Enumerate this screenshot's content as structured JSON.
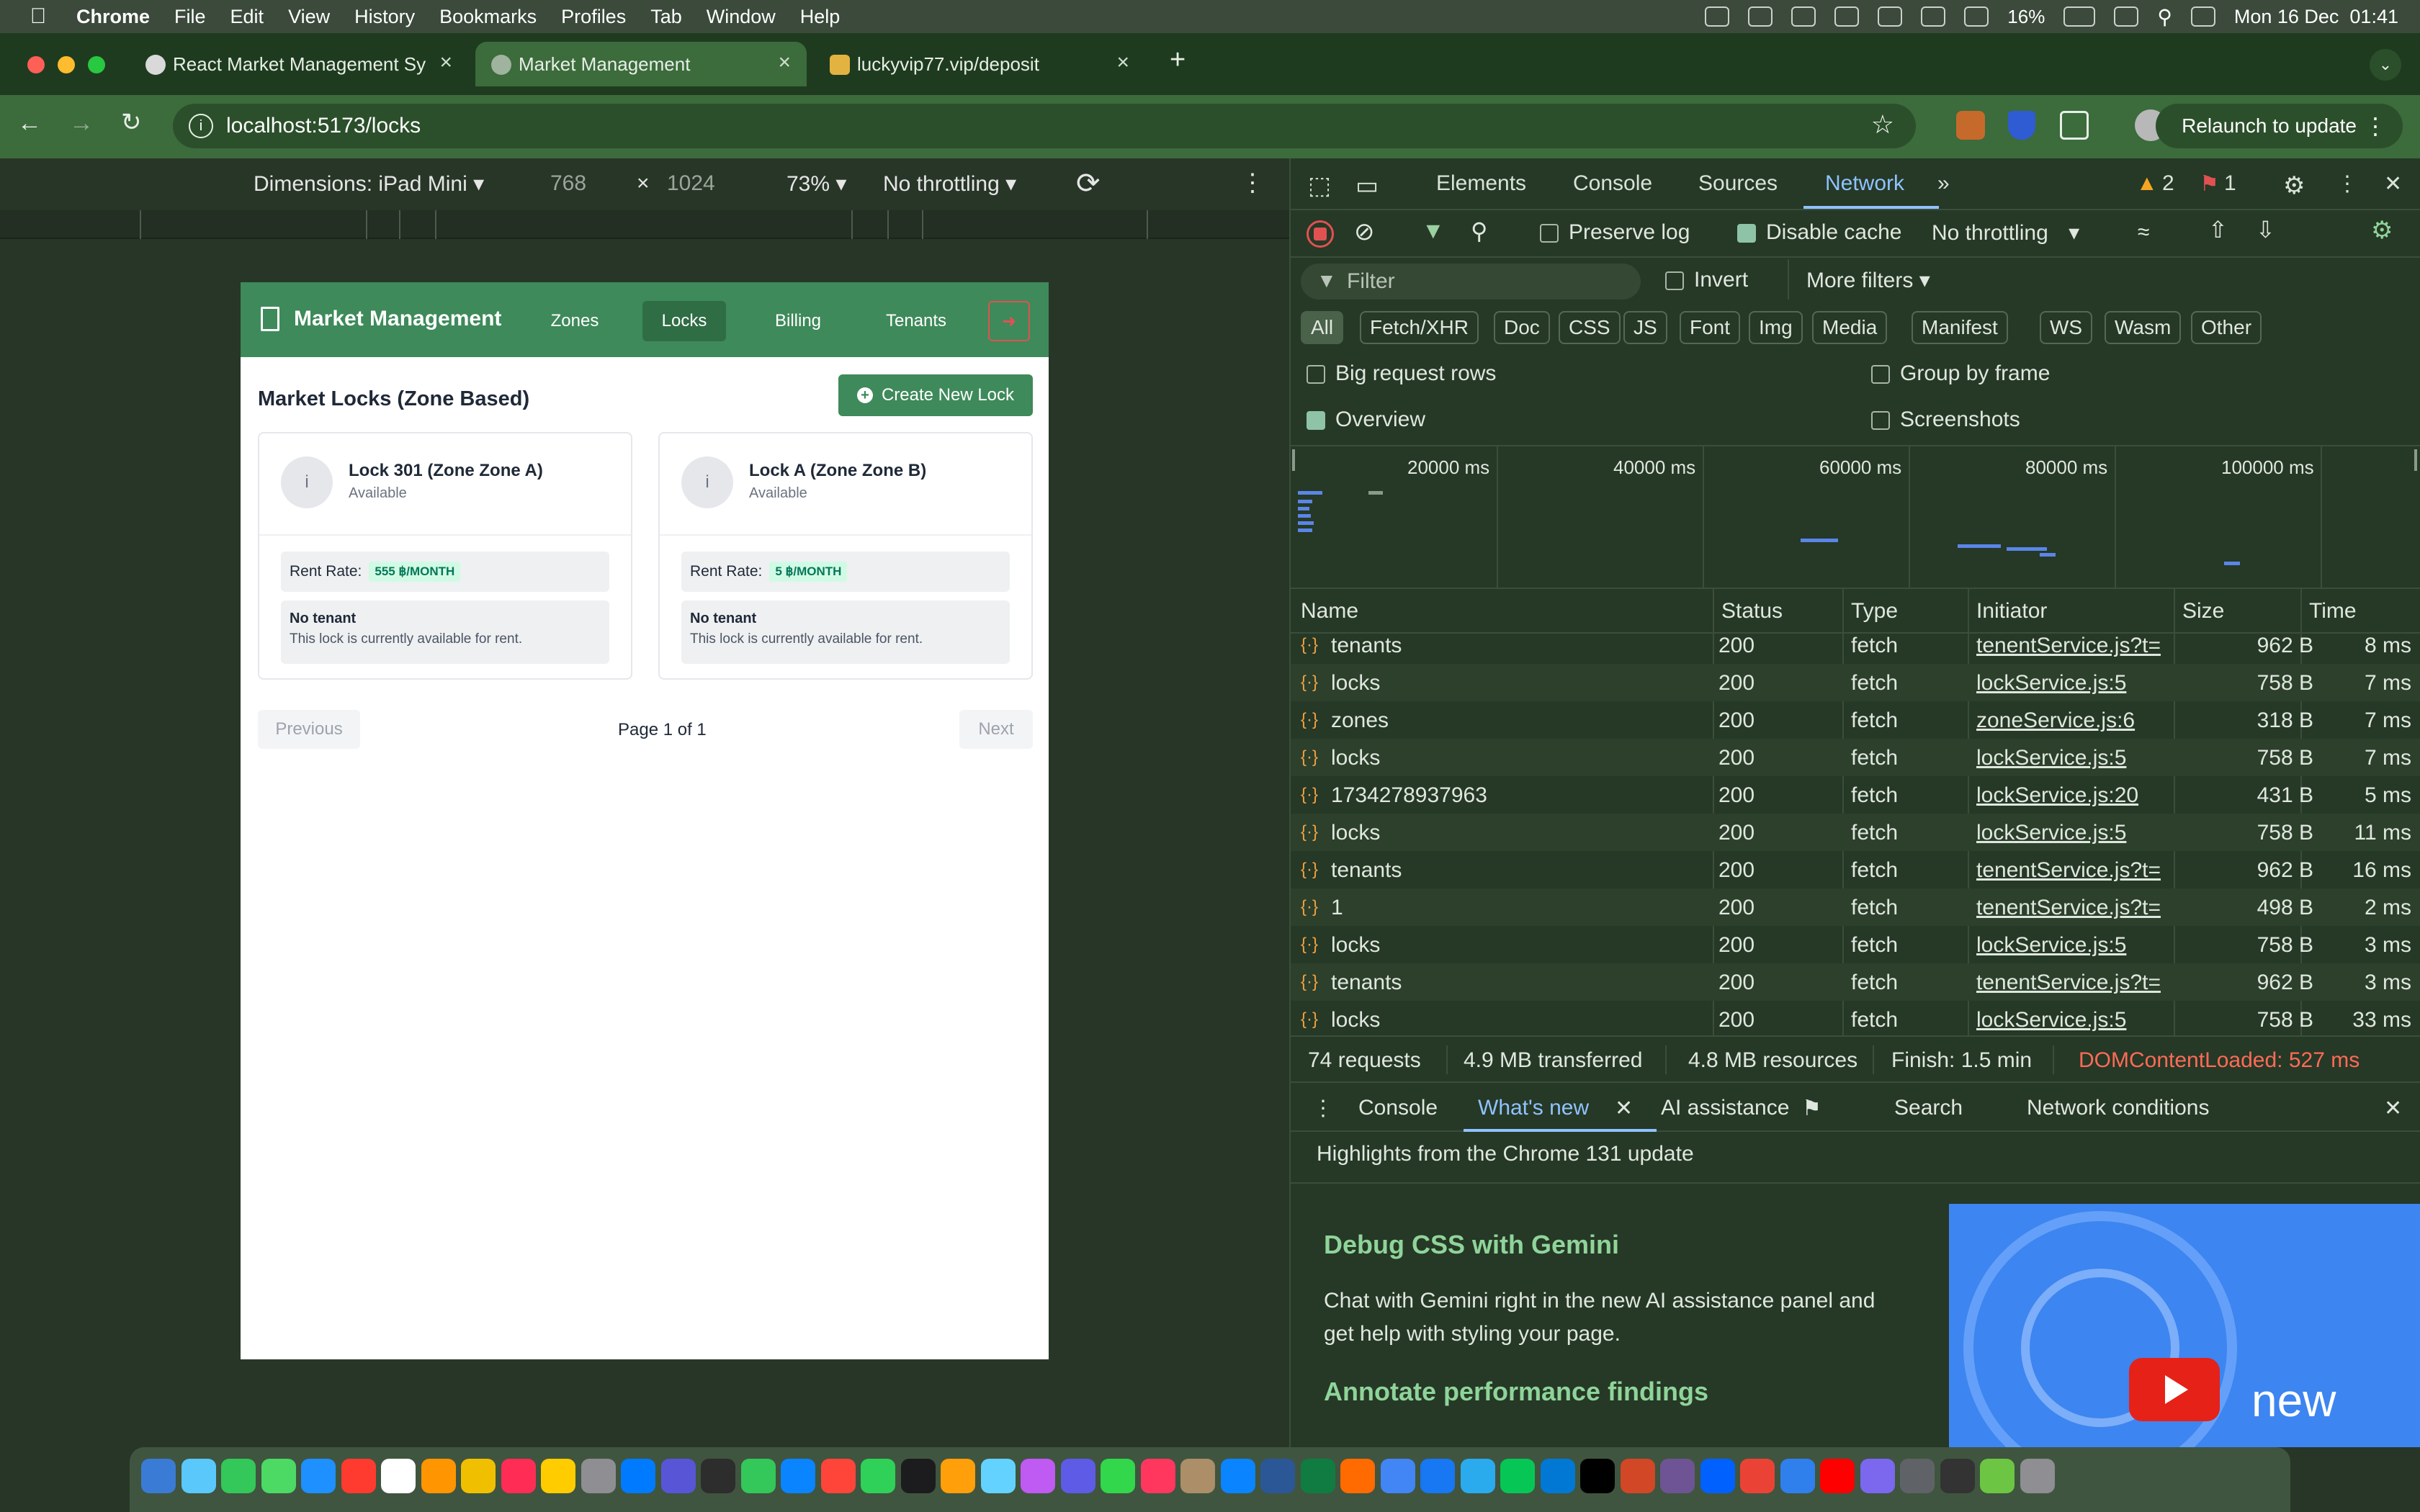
{
  "menubar": {
    "app": "Chrome",
    "items": [
      "File",
      "Edit",
      "View",
      "History",
      "Bookmarks",
      "Profiles",
      "Tab",
      "Window",
      "Help"
    ],
    "battery": "16%",
    "datetime": "Mon 16 Dec  01:41"
  },
  "browser": {
    "tabs": [
      {
        "title": "React Market Management Sy",
        "active": false
      },
      {
        "title": "Market Management",
        "active": true
      },
      {
        "title": "luckyvip77.vip/deposit",
        "active": false
      }
    ],
    "url": "localhost:5173/locks",
    "relaunch_label": "Relaunch to update"
  },
  "device_toolbar": {
    "dimensions_label": "Dimensions: iPad Mini",
    "width": "768",
    "times": "×",
    "height": "1024",
    "zoom": "73%",
    "throttling": "No throttling"
  },
  "app": {
    "brand": "Market Management",
    "nav": [
      {
        "label": "Zones",
        "active": false
      },
      {
        "label": "Locks",
        "active": true
      },
      {
        "label": "Billing",
        "active": false
      },
      {
        "label": "Tenants",
        "active": false
      }
    ],
    "page_title": "Market Locks (Zone Based)",
    "create_button": "Create New Lock",
    "locks": [
      {
        "name": "Lock 301 (Zone Zone A)",
        "status": "Available",
        "rent_label": "Rent Rate:",
        "rent_value": "555 ฿/MONTH",
        "tenant_title": "No tenant",
        "tenant_desc": "This lock is currently available for rent."
      },
      {
        "name": "Lock A (Zone Zone B)",
        "status": "Available",
        "rent_label": "Rent Rate:",
        "rent_value": "5 ฿/MONTH",
        "tenant_title": "No tenant",
        "tenant_desc": "This lock is currently available for rent."
      }
    ],
    "pagination": {
      "previous": "Previous",
      "info": "Page 1 of 1",
      "next": "Next"
    }
  },
  "devtools": {
    "tabs": [
      "Elements",
      "Console",
      "Sources",
      "Network"
    ],
    "active_tab": "Network",
    "warnings": "2",
    "errors": "1",
    "toolbar": {
      "preserve_log": "Preserve log",
      "preserve_log_checked": false,
      "disable_cache": "Disable cache",
      "disable_cache_checked": true,
      "throttling": "No throttling"
    },
    "filter": {
      "placeholder": "Filter",
      "invert": "Invert",
      "more_filters": "More filters"
    },
    "type_filters": [
      "All",
      "Fetch/XHR",
      "Doc",
      "CSS",
      "JS",
      "Font",
      "Img",
      "Media",
      "Manifest",
      "WS",
      "Wasm",
      "Other"
    ],
    "options": {
      "big_request_rows": "Big request rows",
      "group_by_frame": "Group by frame",
      "overview": "Overview",
      "screenshots": "Screenshots"
    },
    "timeline_labels": [
      "20000 ms",
      "40000 ms",
      "60000 ms",
      "80000 ms",
      "100000 ms"
    ],
    "columns": [
      "Name",
      "Status",
      "Type",
      "Initiator",
      "Size",
      "Time"
    ],
    "rows": [
      {
        "name": "tenants",
        "status": "200",
        "type": "fetch",
        "initiator": "tenentService.js?t=",
        "size": "962 B",
        "time": "8 ms"
      },
      {
        "name": "locks",
        "status": "200",
        "type": "fetch",
        "initiator": "lockService.js:5",
        "size": "758 B",
        "time": "7 ms"
      },
      {
        "name": "zones",
        "status": "200",
        "type": "fetch",
        "initiator": "zoneService.js:6",
        "size": "318 B",
        "time": "7 ms"
      },
      {
        "name": "locks",
        "status": "200",
        "type": "fetch",
        "initiator": "lockService.js:5",
        "size": "758 B",
        "time": "7 ms"
      },
      {
        "name": "1734278937963",
        "status": "200",
        "type": "fetch",
        "initiator": "lockService.js:20",
        "size": "431 B",
        "time": "5 ms"
      },
      {
        "name": "locks",
        "status": "200",
        "type": "fetch",
        "initiator": "lockService.js:5",
        "size": "758 B",
        "time": "11 ms"
      },
      {
        "name": "tenants",
        "status": "200",
        "type": "fetch",
        "initiator": "tenentService.js?t=",
        "size": "962 B",
        "time": "16 ms"
      },
      {
        "name": "1",
        "status": "200",
        "type": "fetch",
        "initiator": "tenentService.js?t=",
        "size": "498 B",
        "time": "2 ms"
      },
      {
        "name": "locks",
        "status": "200",
        "type": "fetch",
        "initiator": "lockService.js:5",
        "size": "758 B",
        "time": "3 ms"
      },
      {
        "name": "tenants",
        "status": "200",
        "type": "fetch",
        "initiator": "tenentService.js?t=",
        "size": "962 B",
        "time": "3 ms"
      },
      {
        "name": "locks",
        "status": "200",
        "type": "fetch",
        "initiator": "lockService.js:5",
        "size": "758 B",
        "time": "33 ms"
      }
    ],
    "summary": {
      "requests": "74 requests",
      "transferred": "4.9 MB transferred",
      "resources": "4.8 MB resources",
      "finish": "Finish: 1.5 min",
      "dcl": "DOMContentLoaded: 527 ms"
    },
    "drawer": {
      "tabs": [
        "Console",
        "What's new",
        "AI assistance",
        "Search",
        "Network conditions"
      ],
      "active": "What's new",
      "highlights": "Highlights from the Chrome 131 update",
      "h1": "Debug CSS with Gemini",
      "p1": "Chat with Gemini right in the new AI assistance panel and get help with styling your page.",
      "h2": "Annotate performance findings",
      "promo_label": "new"
    }
  },
  "colors": {
    "app_header": "#3e8a5a",
    "devtools_bg": "#263826",
    "dcl": "#ff6b57",
    "accent_tab": "#8fc3ff"
  }
}
